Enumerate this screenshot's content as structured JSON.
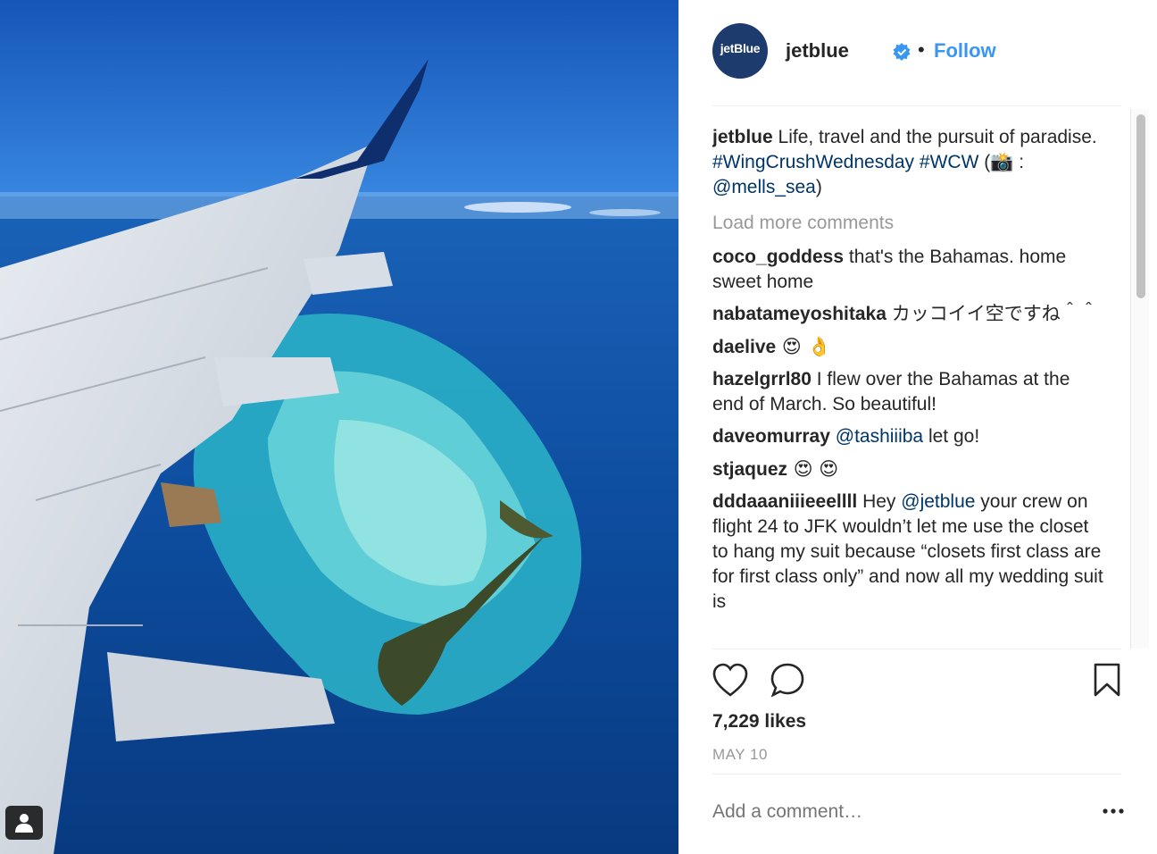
{
  "post": {
    "username": "jetblue",
    "avatar_text": "jetBlue",
    "follow_label": "Follow",
    "separator": "•"
  },
  "caption": {
    "username": "jetblue",
    "text_1": " Life, travel and the pursuit of paradise. ",
    "hashtag_1": "#WingCrushWednesday",
    "hashtag_2": "#WCW",
    "text_2": " (📸 : ",
    "mention": "@mells_sea",
    "text_3": ")"
  },
  "load_more_label": "Load more comments",
  "comments": [
    {
      "username": "coco_goddess",
      "text": " that's the Bahamas. home sweet home"
    },
    {
      "username": "nabatameyoshitaka",
      "text": " カッコイイ空ですね＾＾"
    },
    {
      "username": "daelive",
      "text": " 😍 👌"
    },
    {
      "username": "hazelgrrl80",
      "text": " I flew over the Bahamas at the end of March. So beautiful!"
    },
    {
      "username": "daveomurray",
      "mention": "@tashiiiba",
      "text": " let go!"
    },
    {
      "username": "stjaquez",
      "text": " 😍 😍"
    },
    {
      "username": "dddaaaniiieeellll",
      "text_1": " Hey ",
      "mention": "@jetblue",
      "text_2": " your crew on flight 24 to JFK wouldn’t let me use the closet to hang my suit because “closets first class are for first class only” and now all my wedding suit is"
    }
  ],
  "likes_label": "7,229 likes",
  "date_label": "MAY 10",
  "add_comment_placeholder": "Add a comment…",
  "colors": {
    "link": "#003569",
    "follow": "#3897f0",
    "verified": "#3897f0",
    "muted": "#999999"
  },
  "icons": [
    "tag-people-icon",
    "verified-badge-icon",
    "heart-icon",
    "comment-icon",
    "bookmark-icon",
    "more-options-icon"
  ]
}
